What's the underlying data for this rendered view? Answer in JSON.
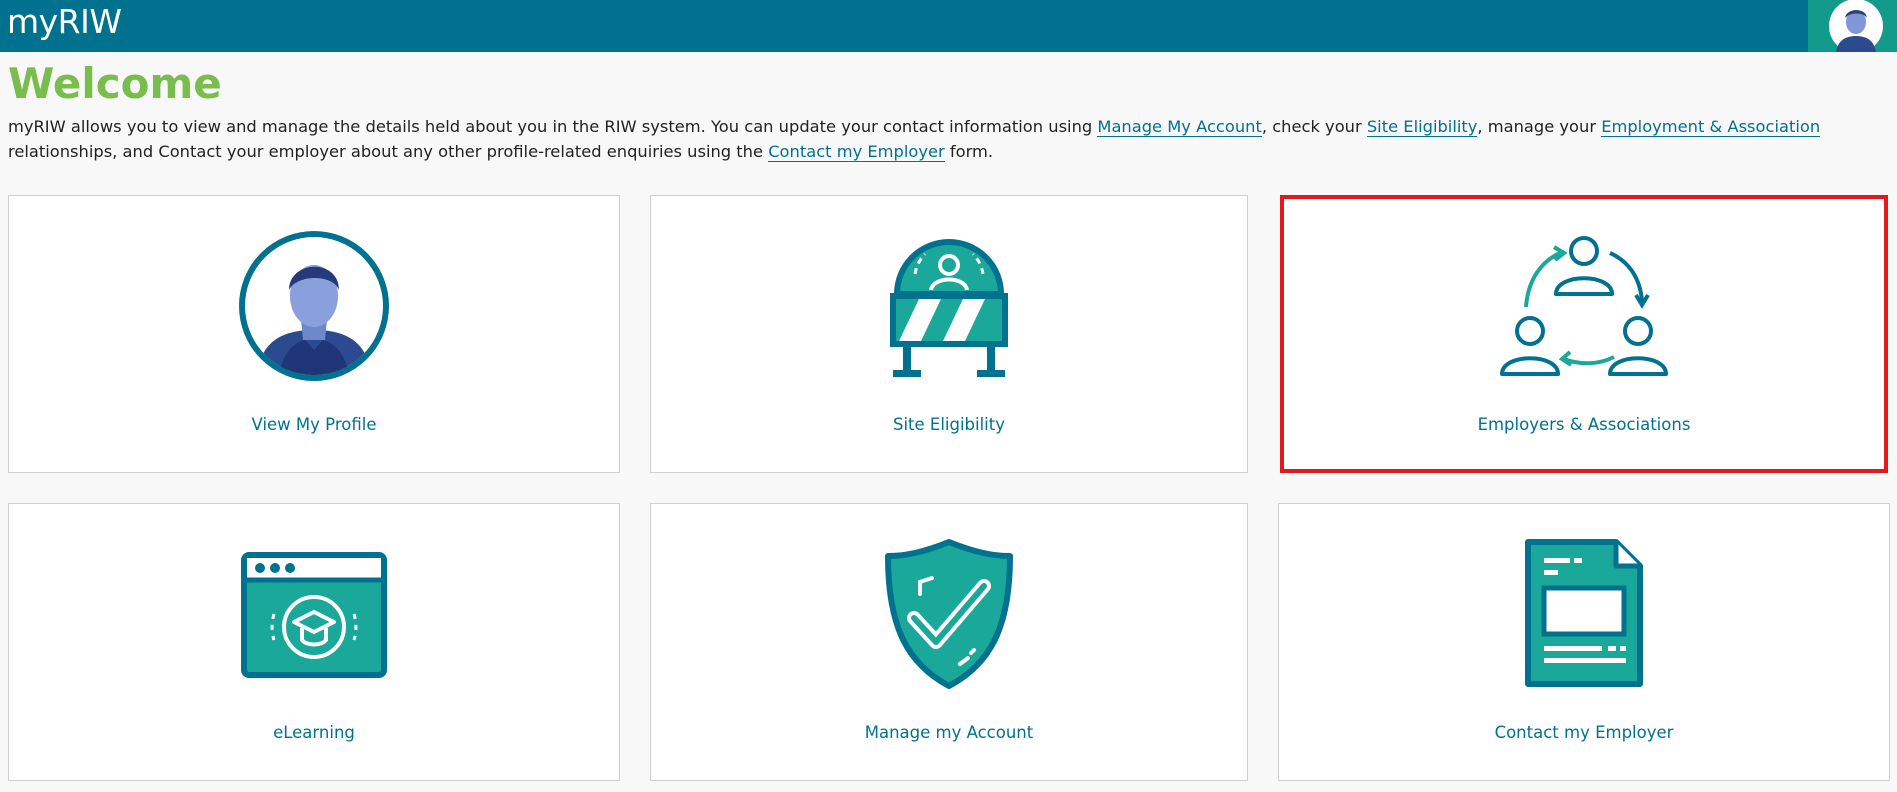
{
  "header": {
    "brand": "myRIW",
    "avatar_icon": "user-avatar-icon",
    "bar_color": "#00718f",
    "avatar_bg": "#129a8a"
  },
  "main": {
    "title": "Welcome",
    "title_color": "#79bd4c",
    "intro": {
      "t1": "myRIW allows you to view and manage the details held about you in the RIW system. You can update your contact information using ",
      "link_manage": "Manage My Account",
      "t2": ", check your ",
      "link_site": "Site Eligibility",
      "t3": ", manage your ",
      "link_employment": "Employment & Association",
      "t4": " relationships, and Contact your employer about any other profile-related enquiries using the ",
      "link_contact": "Contact my Employer",
      "t5": " form."
    },
    "tiles": [
      {
        "label": "View My Profile",
        "icon": "profile-avatar-icon"
      },
      {
        "label": "Site Eligibility",
        "icon": "barrier-icon"
      },
      {
        "label": "Employers & Associations",
        "icon": "people-cycle-icon",
        "highlighted": true
      },
      {
        "label": "eLearning",
        "icon": "elearning-icon"
      },
      {
        "label": "Manage my Account",
        "icon": "shield-check-icon"
      },
      {
        "label": "Contact my Employer",
        "icon": "document-icon"
      }
    ],
    "accent_color": "#00718f",
    "teal_color": "#1aa89a",
    "highlight_color": "#e01b1b"
  }
}
